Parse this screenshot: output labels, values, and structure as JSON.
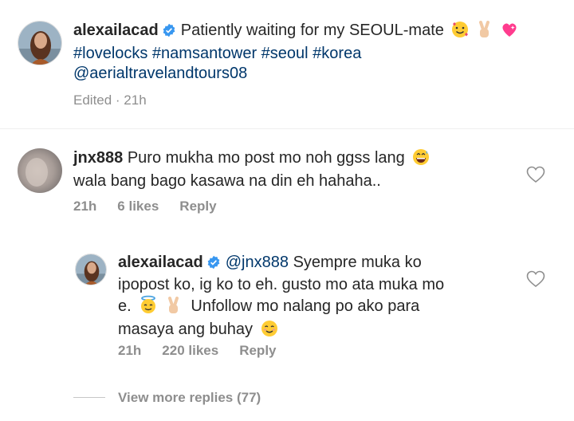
{
  "caption": {
    "username": "alexailacad",
    "text": "Patiently waiting for my SEOUL-mate",
    "hashtags": "#lovelocks #namsantower #seoul #korea",
    "mention": "@aerialtravelandtours08",
    "edited": "Edited · 21h"
  },
  "comment": {
    "username": "jnx888",
    "text_line1": "Puro mukha mo post mo noh ggss lang",
    "text_line2": "wala bang bago kasawa na din eh hahaha..",
    "time": "21h",
    "likes": "6 likes",
    "reply_label": "Reply"
  },
  "reply": {
    "username": "alexailacad",
    "mention": "@jnx888",
    "text_line1": "Syempre muka ko",
    "text_line2": "ipopost ko, ig ko to eh. gusto mo ata muka mo",
    "text_line3_a": "e.",
    "text_line3_b": "Unfollow mo nalang po ako para",
    "text_line4": "masaya ang buhay",
    "time": "21h",
    "likes": "220 likes",
    "reply_label": "Reply"
  },
  "view_more": "View more replies (77)",
  "colors": {
    "verified": "#3897f0",
    "link": "#00376b",
    "meta": "#8e8e8e",
    "divider": "#efefef"
  },
  "icons": [
    "verified-badge-icon",
    "heart-outline-icon"
  ]
}
